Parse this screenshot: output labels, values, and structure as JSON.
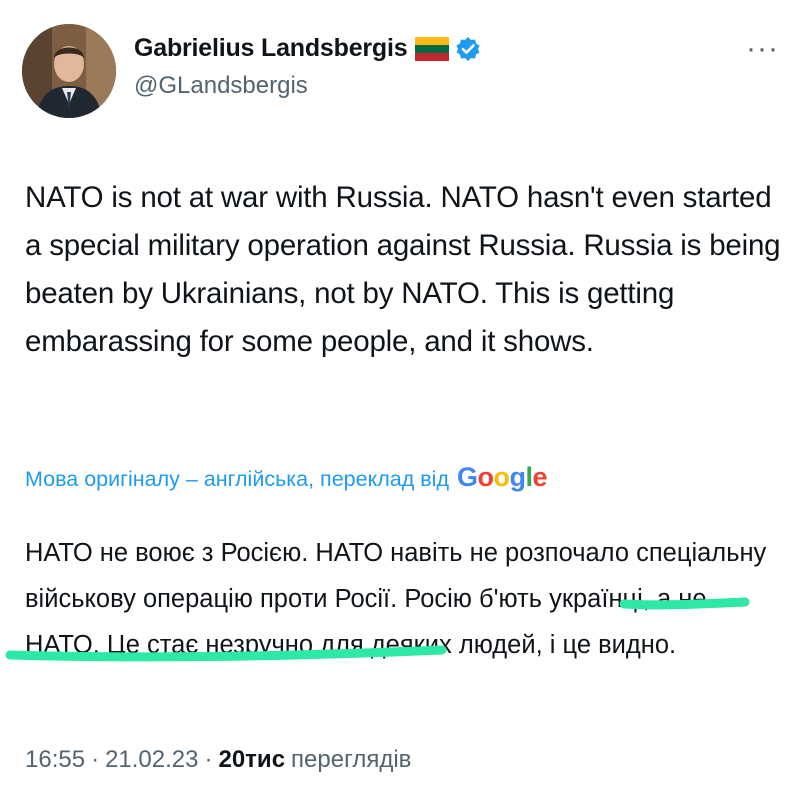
{
  "author": {
    "name": "Gabrielius Landsbergis",
    "handle": "@GLandsbergis",
    "flag_icon": "lithuania-flag-icon",
    "verified_icon": "verified-badge-icon"
  },
  "more_icon": "more-options-icon",
  "more_glyph": "···",
  "tweet": {
    "text": "NATO is not at war with Russia. NATO hasn't even started a special military operation against Russia. Russia is being beaten by Ukrainians, not by NATO. This is getting embarassing for some people, and it shows."
  },
  "translation": {
    "label": "Мова оригіналу – англійська, переклад від",
    "provider": "Google",
    "text": "НАТО не воює з Росією. НАТО навіть не розпочало спеціальну військову операцію проти Росії. Росію б'ють українці, а не НАТО. Це стає незручно для деяких людей, і це видно."
  },
  "meta": {
    "time": "16:55",
    "sep1": "·",
    "date": "21.02.23",
    "sep2": "·",
    "views_count": "20тис",
    "views_label": "переглядів"
  },
  "colors": {
    "highlight": "#2ee8a6",
    "link": "#1d9bf0",
    "verified": "#1d9bf0"
  }
}
